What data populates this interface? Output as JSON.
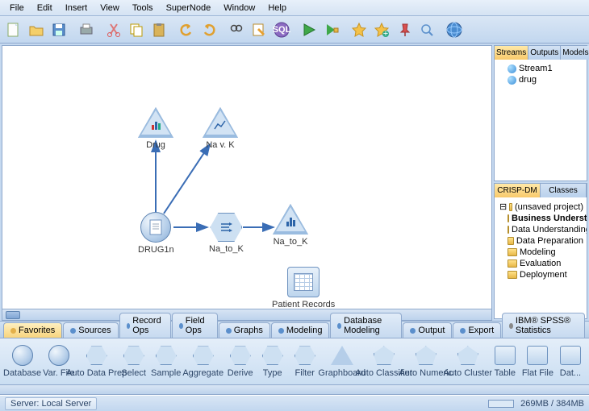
{
  "menu": [
    "File",
    "Edit",
    "Insert",
    "View",
    "Tools",
    "SuperNode",
    "Window",
    "Help"
  ],
  "toolbar_icons": [
    "new-stream",
    "open",
    "save",
    "print",
    "cut",
    "copy",
    "paste",
    "undo",
    "redo",
    "find",
    "edit-node",
    "sql",
    "run",
    "run-selection",
    "favorite",
    "add-favorite",
    "pin",
    "zoom",
    "globe"
  ],
  "right": {
    "top_tabs": [
      "Streams",
      "Outputs",
      "Models"
    ],
    "top_active": 0,
    "streams": [
      "Stream1",
      "drug"
    ],
    "bottom_tabs": [
      "CRISP-DM",
      "Classes"
    ],
    "bottom_active": 0,
    "crisp_root": "(unsaved project)",
    "crisp_items": [
      "Business Understanding",
      "Data Understanding",
      "Data Preparation",
      "Modeling",
      "Evaluation",
      "Deployment"
    ]
  },
  "canvas": {
    "nodes": {
      "drug": {
        "label": "Drug"
      },
      "navk": {
        "label": "Na v. K"
      },
      "drug1n": {
        "label": "DRUG1n"
      },
      "natok": {
        "label": "Na_to_K"
      },
      "natok2": {
        "label": "Na_to_K"
      },
      "patient": {
        "label": "Patient Records"
      }
    }
  },
  "palette_tabs": [
    {
      "label": "Favorites",
      "dot": "y"
    },
    {
      "label": "Sources",
      "dot": "b"
    },
    {
      "label": "Record Ops",
      "dot": "b"
    },
    {
      "label": "Field Ops",
      "dot": "b"
    },
    {
      "label": "Graphs",
      "dot": "b"
    },
    {
      "label": "Modeling",
      "dot": "b"
    },
    {
      "label": "Database Modeling",
      "dot": "b"
    },
    {
      "label": "Output",
      "dot": "b"
    },
    {
      "label": "Export",
      "dot": "b"
    },
    {
      "label": "IBM® SPSS® Statistics",
      "dot": "g"
    }
  ],
  "palette_active": 0,
  "palette_items": [
    {
      "label": "Database",
      "shape": "circ"
    },
    {
      "label": "Var. File",
      "shape": "circ"
    },
    {
      "label": "Auto Data Prep",
      "shape": "hex"
    },
    {
      "label": "Select",
      "shape": "hex"
    },
    {
      "label": "Sample",
      "shape": "hex"
    },
    {
      "label": "Aggregate",
      "shape": "hex"
    },
    {
      "label": "Derive",
      "shape": "hex"
    },
    {
      "label": "Type",
      "shape": "hex"
    },
    {
      "label": "Filter",
      "shape": "hex"
    },
    {
      "label": "Graphboard",
      "shape": "tri"
    },
    {
      "label": "Auto Classifier",
      "shape": "pent"
    },
    {
      "label": "Auto Numeric",
      "shape": "pent"
    },
    {
      "label": "Auto Cluster",
      "shape": "pent"
    },
    {
      "label": "Table",
      "shape": "sq"
    },
    {
      "label": "Flat File",
      "shape": "sq"
    },
    {
      "label": "Dat...",
      "shape": "sq"
    }
  ],
  "status": {
    "server": "Server: Local Server",
    "memory": "269MB / 384MB"
  }
}
